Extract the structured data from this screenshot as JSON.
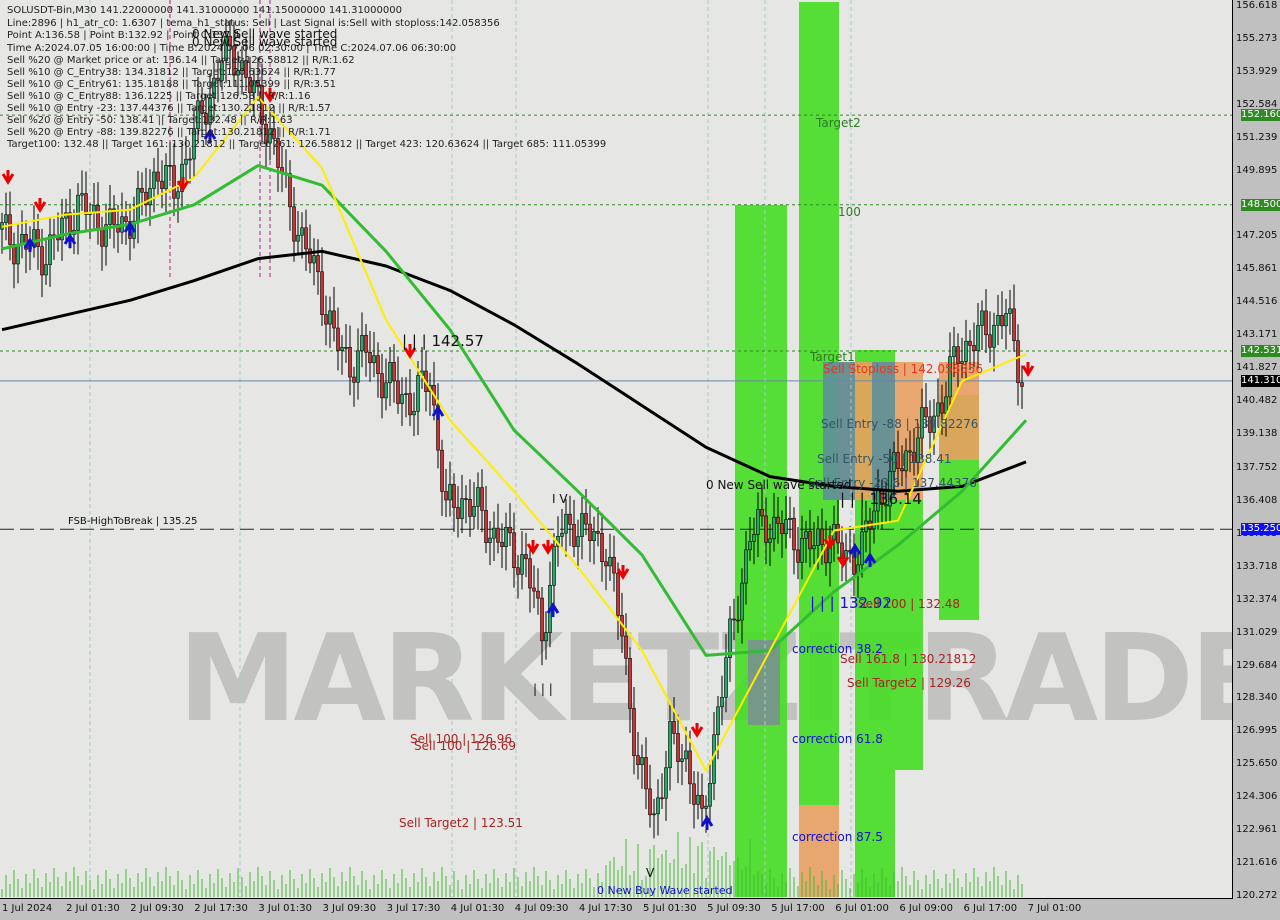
{
  "header": {
    "line1": "SOLUSDT-Bin,M30  141.22000000 141.31000000 141.15000000 141.31000000",
    "line2": "Line:2896 | h1_atr_c0: 1.6307 | tema_h1_status: Sell | Last Signal is:Sell with stoploss:142.058356",
    "line3": "Point A:136.58 | Point B:132.92 | Point C:137.4",
    "line4": "Time A:2024.07.05 16:00:00 | Time B:2024.07.06 02:30:00 | Time C:2024.07.06 06:30:00",
    "sells": [
      "Sell %20 @ Market price or at: 136.14 || Target:126.58812 || R/R:1.62",
      "Sell %10 @ C_Entry38: 134.31812 || Target:120.63624 || R/R:1.77",
      "Sell %10 @ C_Entry61: 135.18188 || Target:111.05399 || R/R:3.51",
      "Sell %10 @ C_Entry88: 136.1225 || Target:126.58 || R/R:1.16",
      "Sell %10 @ Entry -23: 137.44376 || Target:130.21812 || R/R:1.57",
      "Sell %20 @ Entry -50: 138.41 || Target:132.48 || R/R:1.63",
      "Sell %20 @ Entry -88: 139.82276 || Target:130.21812 || R/R:1.71"
    ],
    "targets": "Target100: 132.48 || Target 161: 130.21812 || Target 261: 126.58812 || Target 423: 120.63624 || Target 685: 111.05399"
  },
  "annotations": {
    "wave_top_1": "0 New Sell wave started",
    "wave_top_2": "0 New Sell wave started",
    "hundred_top": "100",
    "target2": "Target2",
    "hundred": "100",
    "target1": "Target1",
    "sell_stoploss": "Sell Stoploss | 142.058356",
    "sell_entry_88": "Sell Entry -88 | 139.82276",
    "sell_entry_50": "Sell Entry -50 | 138.41",
    "sell_entry_23": "Sell Entry -23.6 | 137.44376",
    "new_sell_wave": "0 New Sell wave started",
    "point_c": "| | | 136.14",
    "point_b": "| | | 132.92",
    "sell_100": "Sell 100 | 132.48",
    "correction_38": "correction 38.2",
    "sell_161": "Sell 161.8 | 130.21812",
    "sell_target2": "Sell Target2 | 129.26",
    "correction_61": "correction 61.8",
    "correction_87": "correction 87.5",
    "fsb": "FSB-HighToBreak | 135.25",
    "point_a_left": "| | | 142.57",
    "iv": "I V",
    "iii": "| | |",
    "sell_100_a": "Sell 100 | 126.96",
    "sell_100_b": "Sell 100 | 126.69",
    "sell_target2_left": "Sell Target2 | 123.51",
    "v_mark": "V",
    "new_buy_wave": "0 New Buy Wave started"
  },
  "watermark": "MARKETZITRADE",
  "price_tags": [
    {
      "value": "152.160",
      "price": 152.16,
      "color": "#2e8b22"
    },
    {
      "value": "148.500",
      "price": 148.5,
      "color": "#2e8b22"
    },
    {
      "value": "142.531",
      "price": 142.531,
      "color": "#2e8b22"
    },
    {
      "value": "141.310",
      "price": 141.31,
      "color": "#000000"
    },
    {
      "value": "135.250",
      "price": 135.25,
      "color": "#1010ee"
    }
  ],
  "chart_data": {
    "type": "candlestick",
    "symbol": "SOLUSDT-Bin",
    "timeframe": "M30",
    "ylim": [
      120.272,
      156.618
    ],
    "y_ticks": [
      "156.618",
      "155.273",
      "153.929",
      "152.584",
      "151.239",
      "149.895",
      "147.205",
      "145.861",
      "144.516",
      "143.171",
      "141.827",
      "140.482",
      "139.138",
      "137.752",
      "136.408",
      "135.063",
      "133.718",
      "132.374",
      "131.029",
      "129.684",
      "128.340",
      "126.995",
      "125.650",
      "124.306",
      "122.961",
      "121.616",
      "120.272"
    ],
    "x_ticks": [
      "1 Jul 2024",
      "2 Jul 01:30",
      "2 Jul 09:30",
      "2 Jul 17:30",
      "3 Jul 01:30",
      "3 Jul 09:30",
      "3 Jul 17:30",
      "4 Jul 01:30",
      "4 Jul 09:30",
      "4 Jul 17:30",
      "5 Jul 01:30",
      "5 Jul 09:30",
      "5 Jul 17:00",
      "6 Jul 01:00",
      "6 Jul 09:00",
      "6 Jul 17:00",
      "7 Jul 01:00"
    ],
    "close_2h": [
      147.5,
      147,
      146.8,
      146.5,
      147.5,
      148.5,
      148,
      147.5,
      147.8,
      148.5,
      150,
      149,
      151,
      152.5,
      154.5,
      154.5,
      153,
      151.5,
      149,
      147,
      145.5,
      143,
      142,
      142.5,
      141.5,
      140.8,
      140.5,
      141.5,
      136,
      136.5,
      136,
      135,
      134.5,
      133.8,
      131,
      135,
      135.5,
      135,
      134.5,
      131,
      125.5,
      123.5,
      126.5,
      126,
      123,
      128,
      131.5,
      135,
      135.5,
      135.3,
      134.8,
      134.5,
      135,
      134,
      134.5,
      136.5,
      137.5,
      138.5,
      139.5,
      140.5,
      142.5,
      143,
      143.5,
      144,
      141.5
    ],
    "ma_black": [
      143.4,
      144,
      144.6,
      145.4,
      146.3,
      146.6,
      146,
      145,
      143.6,
      142,
      140.3,
      138.6,
      137.4,
      137,
      136.8,
      137,
      138
    ],
    "ma_green": [
      146.7,
      147.3,
      147.7,
      148.5,
      150.1,
      149.3,
      146.6,
      143.4,
      139.3,
      136.8,
      134.2,
      130.1,
      130.3,
      132.7,
      134.6,
      136.8,
      139.7
    ],
    "tema_yellow": [
      147.6,
      148.1,
      148.3,
      149.6,
      152.9,
      150,
      143.8,
      139.7,
      136.8,
      133.7,
      130.3,
      125.4,
      130.3,
      135.2,
      135.6,
      141.3,
      142.4
    ],
    "levels": {
      "target2": 152.16,
      "hundred": 148.5,
      "target1": 142.531,
      "last_price": 141.31,
      "fsb_high_to_break": 135.25
    },
    "colors": {
      "bull": "#22aa66",
      "bear": "#cc3333",
      "ma_black": "#000000",
      "ma_green": "#33bb33",
      "tema": "#ffee00",
      "zone_green": "#44dd22",
      "zone_orange": "#e8a060"
    }
  }
}
